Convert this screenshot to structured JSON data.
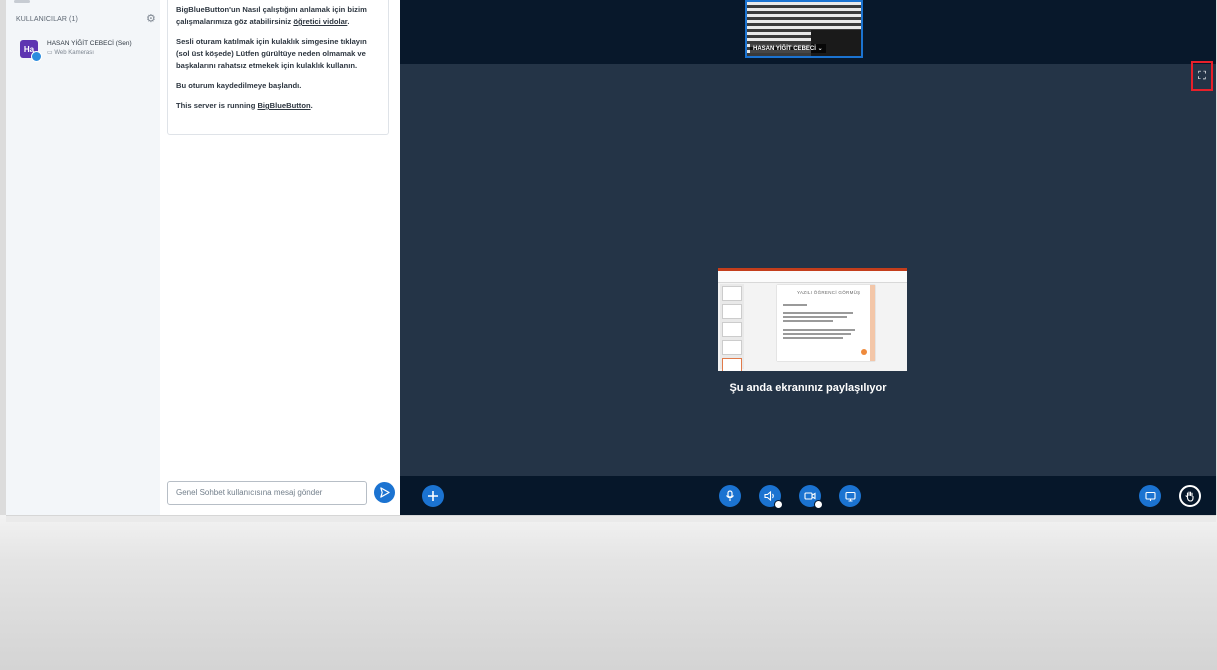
{
  "users": {
    "header": "KULLANICILAR (1)",
    "items": [
      {
        "initials": "Ha",
        "name": "HASAN YİĞİT CEBECİ (Sen)",
        "subtitle": "Web Kamerası"
      }
    ]
  },
  "chat": {
    "welcome_line1": "BigBlueButton'un Nasıl çalıştığını anlamak için bizim çalışmalarımıza göz atabilirsiniz ",
    "welcome_link1": "öğretici vidolar",
    "welcome_line1_end": ".",
    "welcome_line2": "Sesli oturam katılmak için kulaklık simgesine tıklayın (sol üst köşede) Lütfen gürültüye neden olmamak ve başkalarını rahatsız etmekek için kulaklık kullanın.",
    "welcome_line3": "Bu oturum kaydedilmeye başlandı.",
    "welcome_line4": "This server is running ",
    "welcome_link2": "BigBlueButton",
    "welcome_line4_end": ".",
    "input_placeholder": "Genel Sohbet kullanıcısına mesaj gönder"
  },
  "webcam": {
    "label": "HASAN YİĞİT CEBECİ"
  },
  "main": {
    "screenshare_text": "Şu anda ekranınız paylaşılıyor",
    "slide_title": "YAZILI ÖĞRENCİ GÖRMÜŞ"
  },
  "icons": {
    "gear": "gear-icon",
    "fullscreen": "fullscreen-icon",
    "send": "send-icon",
    "plus": "plus-icon",
    "mic": "microphone-icon",
    "audio": "audio-icon",
    "camera": "camera-icon",
    "screenshare": "screenshare-icon",
    "presentation": "presentation-icon",
    "hand": "raise-hand-icon"
  },
  "colors": {
    "accent": "#1b73d1",
    "main_bg": "#243447",
    "bar_bg": "#06172a",
    "highlight": "#e8202a"
  }
}
